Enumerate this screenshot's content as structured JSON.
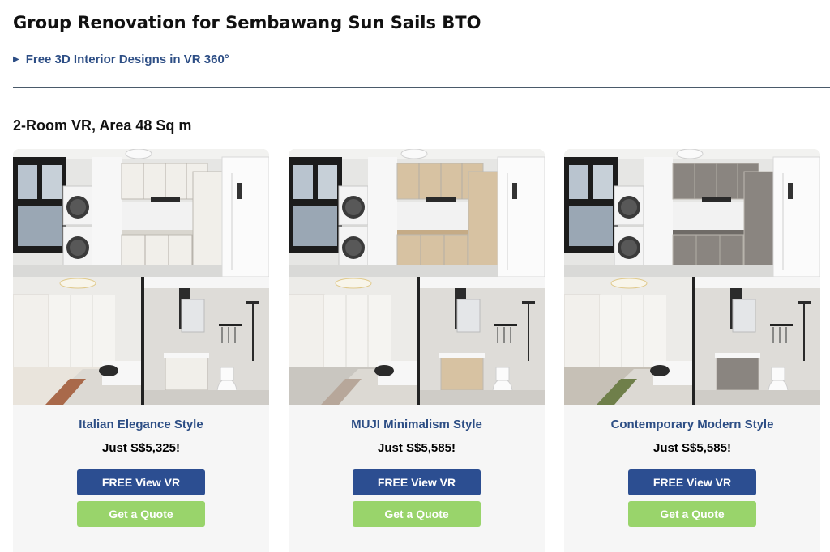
{
  "page": {
    "title": "Group Renovation for Sembawang Sun Sails BTO",
    "details_summary": "Free 3D Interior Designs in VR 360°",
    "section_title": "2-Room VR, Area 48 Sq m"
  },
  "cards": [
    {
      "style_name": "Italian Elegance Style",
      "price": "Just S$5,325!",
      "vr_label": "FREE View VR",
      "quote_label": "Get a Quote",
      "palette": {
        "cabinet": "#f1efea",
        "counter": "#d9d6cf",
        "room_floor": "#e9e4dc",
        "accent": "#a9694a"
      }
    },
    {
      "style_name": "MUJI Minimalism Style",
      "price": "Just S$5,585!",
      "vr_label": "FREE View VR",
      "quote_label": "Get a Quote",
      "palette": {
        "cabinet": "#d7c2a2",
        "counter": "#c5ab86",
        "room_floor": "#c9c6c0",
        "accent": "#b7a79a"
      }
    },
    {
      "style_name": "Contemporary Modern Style",
      "price": "Just S$5,585!",
      "vr_label": "FREE View VR",
      "quote_label": "Get a Quote",
      "palette": {
        "cabinet": "#8a8580",
        "counter": "#6f6b67",
        "room_floor": "#c6c0b6",
        "accent": "#6f7f4a"
      }
    }
  ],
  "colors": {
    "link_blue": "#2d4e85",
    "primary_button": "#2c4e91",
    "quote_button": "#99d46b",
    "card_bg": "#f6f6f6"
  }
}
